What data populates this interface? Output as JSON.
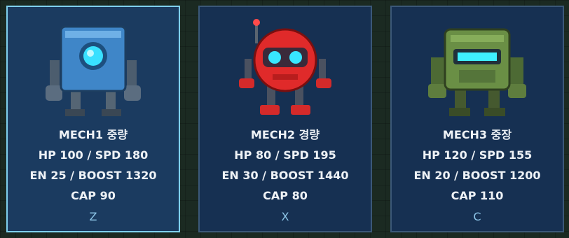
{
  "mechs": [
    {
      "name": "MECH1 중량",
      "stats1": "HP 100 / SPD 180",
      "stats2": "EN 25 / BOOST 1320",
      "cap": "CAP 90",
      "key": "Z",
      "selected": true
    },
    {
      "name": "MECH2 경량",
      "stats1": "HP 80 / SPD 195",
      "stats2": "EN 30 / BOOST 1440",
      "cap": "CAP 80",
      "key": "X",
      "selected": false
    },
    {
      "name": "MECH3 중장",
      "stats1": "HP 120 / SPD 155",
      "stats2": "EN 20 / BOOST 1200",
      "cap": "CAP 110",
      "key": "C",
      "selected": false
    }
  ],
  "colors": {
    "card_bg": "#163052",
    "selected_border": "#7fd0ee",
    "key_text": "#8cc4e6"
  },
  "icons": [
    "blue-box-robot-icon",
    "red-ball-robot-icon",
    "green-tank-robot-icon"
  ]
}
